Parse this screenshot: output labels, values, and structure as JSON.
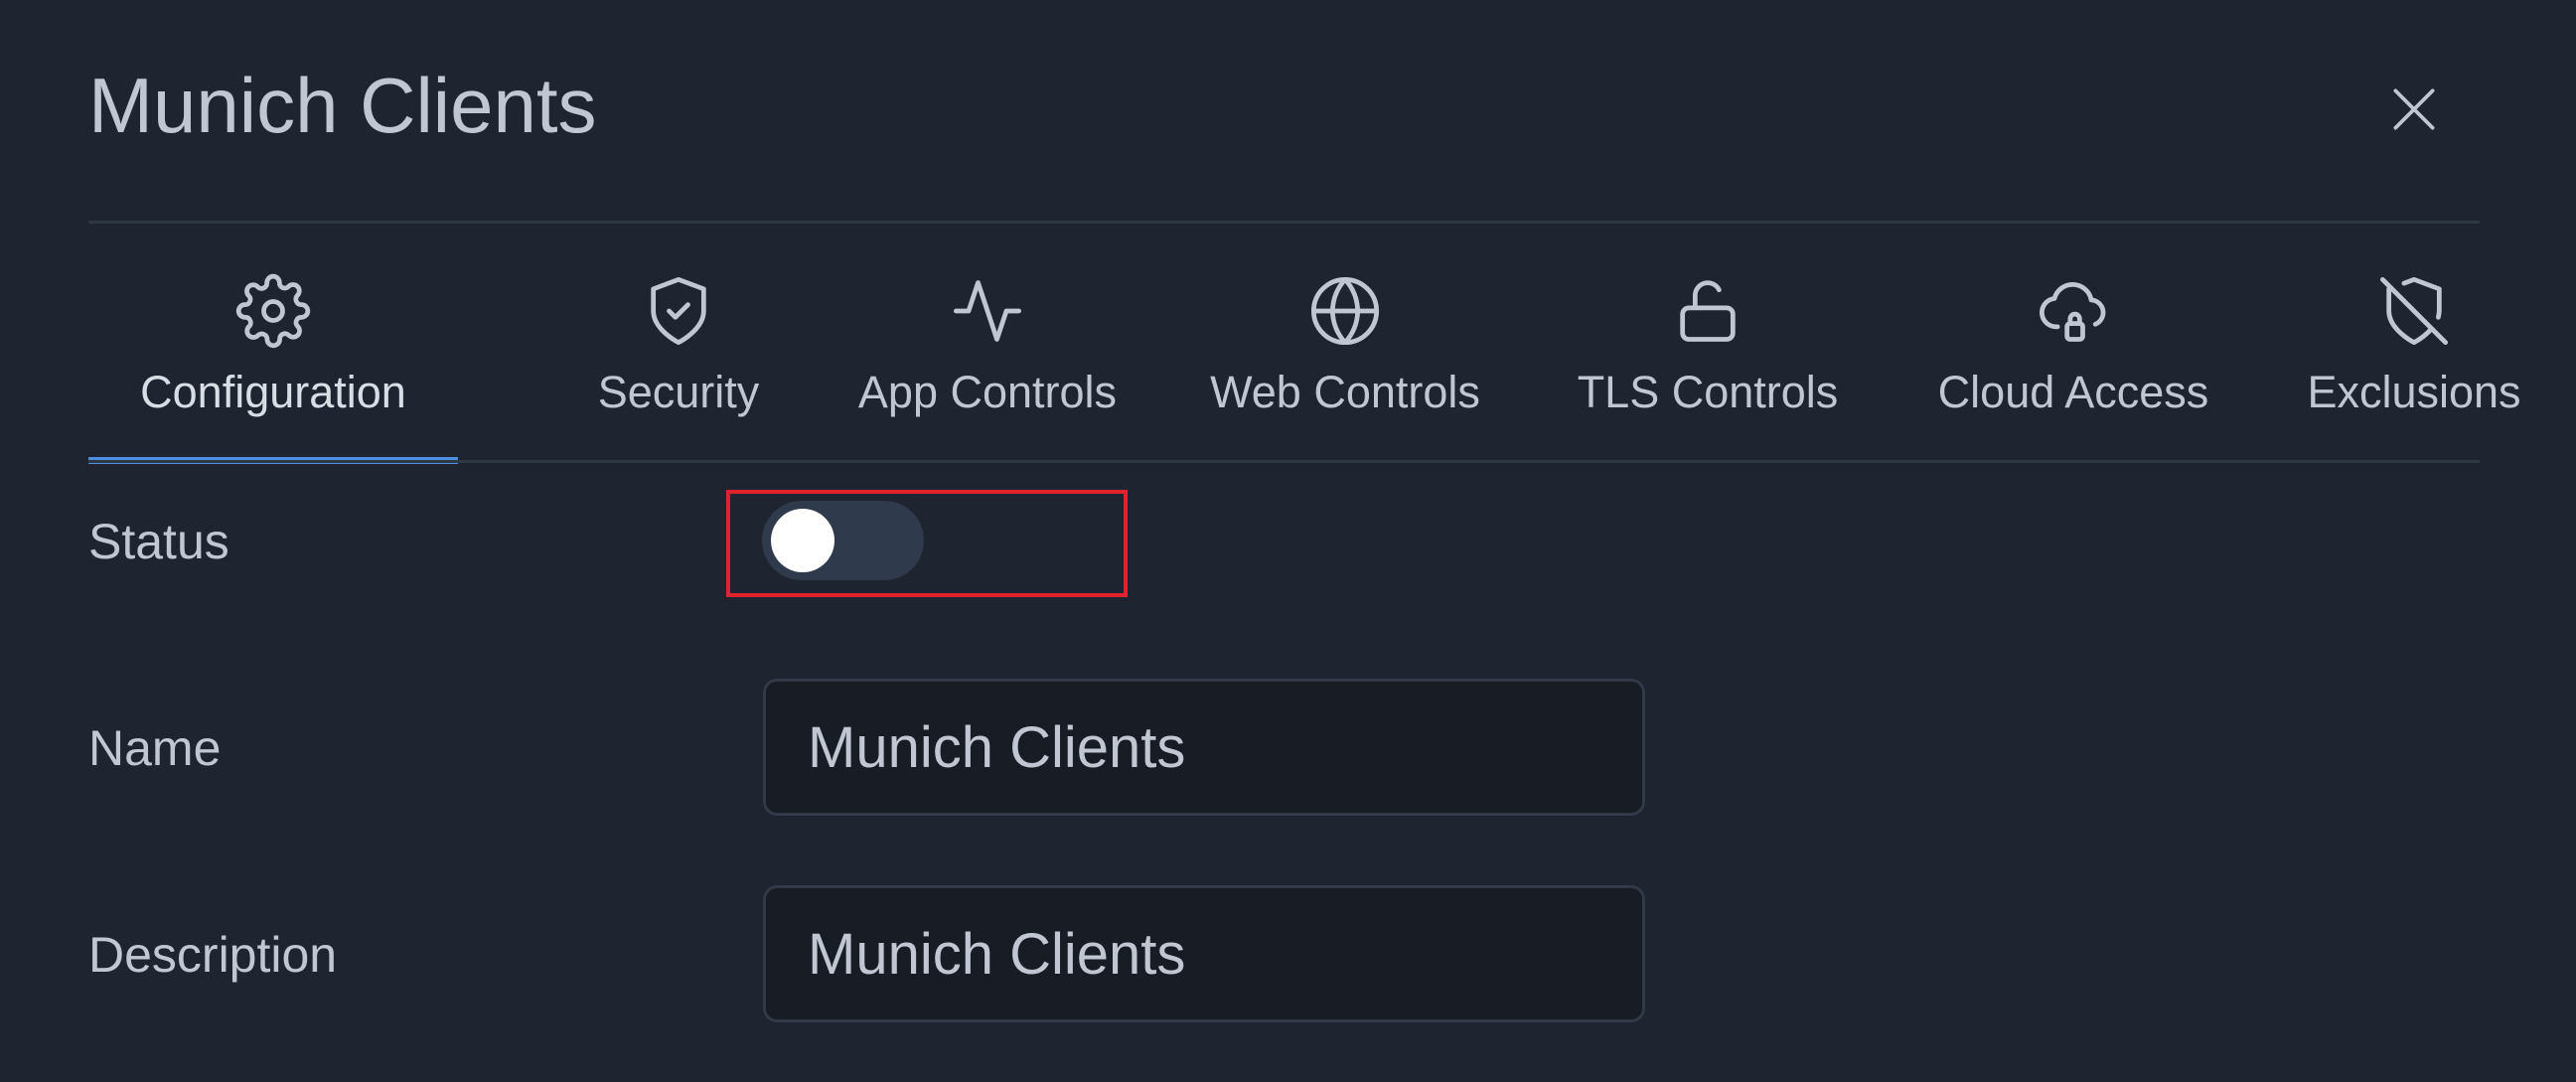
{
  "dialog": {
    "title": "Munich Clients"
  },
  "tabs": [
    {
      "label": "Configuration",
      "icon": "gear-icon",
      "active": true
    },
    {
      "label": "Security",
      "icon": "shield-check-icon",
      "active": false
    },
    {
      "label": "App Controls",
      "icon": "activity-icon",
      "active": false
    },
    {
      "label": "Web Controls",
      "icon": "globe-icon",
      "active": false
    },
    {
      "label": "TLS Controls",
      "icon": "unlock-icon",
      "active": false
    },
    {
      "label": "Cloud Access",
      "icon": "cloud-lock-icon",
      "active": false
    },
    {
      "label": "Exclusions",
      "icon": "shield-off-icon",
      "active": false
    }
  ],
  "form": {
    "status_label": "Status",
    "status_enabled": false,
    "name_label": "Name",
    "name_value": "Munich Clients",
    "description_label": "Description",
    "description_value": "Munich Clients"
  },
  "colors": {
    "background": "#1f2530",
    "text": "#c1c7d2",
    "accent": "#4a8fe0",
    "focus_outline": "#e0232e",
    "toggle_track": "#2f3b4c",
    "input_background": "#181d25"
  }
}
